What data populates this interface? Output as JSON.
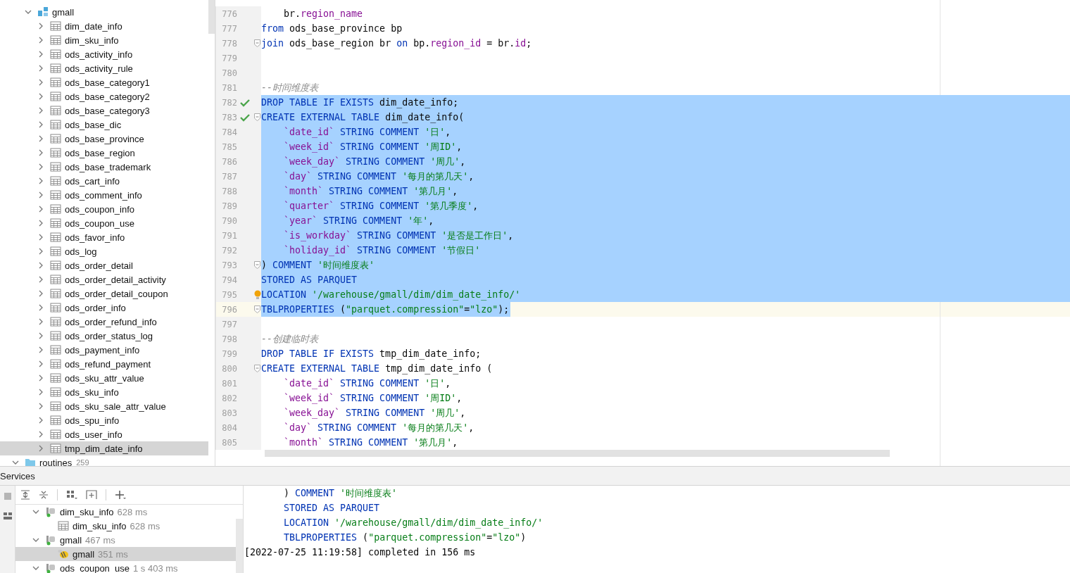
{
  "db_tree": {
    "schema": {
      "label": "gmall",
      "expanded": true,
      "children": [
        {
          "label": "dim_date_info",
          "selected": false
        },
        {
          "label": "dim_sku_info",
          "selected": false
        },
        {
          "label": "ods_activity_info",
          "selected": false
        },
        {
          "label": "ods_activity_rule",
          "selected": false
        },
        {
          "label": "ods_base_category1",
          "selected": false
        },
        {
          "label": "ods_base_category2",
          "selected": false
        },
        {
          "label": "ods_base_category3",
          "selected": false
        },
        {
          "label": "ods_base_dic",
          "selected": false
        },
        {
          "label": "ods_base_province",
          "selected": false
        },
        {
          "label": "ods_base_region",
          "selected": false
        },
        {
          "label": "ods_base_trademark",
          "selected": false
        },
        {
          "label": "ods_cart_info",
          "selected": false
        },
        {
          "label": "ods_comment_info",
          "selected": false
        },
        {
          "label": "ods_coupon_info",
          "selected": false
        },
        {
          "label": "ods_coupon_use",
          "selected": false
        },
        {
          "label": "ods_favor_info",
          "selected": false
        },
        {
          "label": "ods_log",
          "selected": false
        },
        {
          "label": "ods_order_detail",
          "selected": false
        },
        {
          "label": "ods_order_detail_activity",
          "selected": false
        },
        {
          "label": "ods_order_detail_coupon",
          "selected": false
        },
        {
          "label": "ods_order_info",
          "selected": false
        },
        {
          "label": "ods_order_refund_info",
          "selected": false
        },
        {
          "label": "ods_order_status_log",
          "selected": false
        },
        {
          "label": "ods_payment_info",
          "selected": false
        },
        {
          "label": "ods_refund_payment",
          "selected": false
        },
        {
          "label": "ods_sku_attr_value",
          "selected": false
        },
        {
          "label": "ods_sku_info",
          "selected": false
        },
        {
          "label": "ods_sku_sale_attr_value",
          "selected": false
        },
        {
          "label": "ods_spu_info",
          "selected": false
        },
        {
          "label": "ods_user_info",
          "selected": false
        },
        {
          "label": "tmp_dim_date_info",
          "selected": true
        }
      ]
    },
    "routines": {
      "label": "routines",
      "count": "259",
      "expanded": true
    }
  },
  "editor": {
    "lines": [
      {
        "no": "776",
        "indented": true,
        "selected": false,
        "current": false,
        "fold": false,
        "ok": false,
        "bulb": false,
        "segs": [
          {
            "kind": "plain",
            "text": "br."
          },
          {
            "kind": "field",
            "text": "region_name"
          }
        ]
      },
      {
        "no": "777",
        "indented": false,
        "selected": false,
        "current": false,
        "fold": false,
        "ok": false,
        "bulb": false,
        "segs": [
          {
            "kind": "keyword",
            "text": "from"
          },
          {
            "kind": "plain",
            "text": " ods_base_province bp"
          }
        ]
      },
      {
        "no": "778",
        "indented": false,
        "selected": false,
        "current": false,
        "fold": true,
        "ok": false,
        "bulb": false,
        "segs": [
          {
            "kind": "keyword",
            "text": "join"
          },
          {
            "kind": "plain",
            "text": " ods_base_region br "
          },
          {
            "kind": "keyword",
            "text": "on"
          },
          {
            "kind": "plain",
            "text": " bp."
          },
          {
            "kind": "field",
            "text": "region_id"
          },
          {
            "kind": "plain",
            "text": " = br."
          },
          {
            "kind": "field",
            "text": "id"
          },
          {
            "kind": "plain",
            "text": ";"
          }
        ]
      },
      {
        "no": "779",
        "selected": false,
        "current": false,
        "fold": false,
        "ok": false,
        "bulb": false
      },
      {
        "no": "780",
        "selected": false,
        "current": false,
        "fold": false,
        "ok": false,
        "bulb": false
      },
      {
        "no": "781",
        "indented": false,
        "selected": false,
        "current": false,
        "fold": false,
        "ok": false,
        "bulb": false,
        "segs": [
          {
            "kind": "comment",
            "text": "--时间维度表"
          }
        ]
      },
      {
        "no": "782",
        "indented": false,
        "selected": true,
        "current": false,
        "fold": false,
        "ok": true,
        "bulb": false,
        "segs": [
          {
            "kind": "keyword",
            "text": "DROP TABLE IF EXISTS"
          },
          {
            "kind": "plain",
            "text": " dim_date_info;"
          }
        ]
      },
      {
        "no": "783",
        "indented": false,
        "selected": true,
        "current": false,
        "fold": true,
        "ok": true,
        "bulb": false,
        "segs": [
          {
            "kind": "keyword",
            "text": "CREATE EXTERNAL TABLE"
          },
          {
            "kind": "plain",
            "text": " dim_date_info("
          }
        ]
      },
      {
        "no": "784",
        "indented": true,
        "selected": true,
        "current": false,
        "fold": false,
        "ok": false,
        "bulb": false,
        "segs": [
          {
            "kind": "field",
            "text": "`date_id`"
          },
          {
            "kind": "keyword",
            "text": " STRING COMMENT"
          },
          {
            "kind": "string",
            "text": " '日'"
          },
          {
            "kind": "plain",
            "text": ","
          }
        ]
      },
      {
        "no": "785",
        "indented": true,
        "selected": true,
        "current": false,
        "fold": false,
        "ok": false,
        "bulb": false,
        "segs": [
          {
            "kind": "field",
            "text": "`week_id`"
          },
          {
            "kind": "keyword",
            "text": " STRING COMMENT"
          },
          {
            "kind": "string",
            "text": " '周ID'"
          },
          {
            "kind": "plain",
            "text": ","
          }
        ]
      },
      {
        "no": "786",
        "indented": true,
        "selected": true,
        "current": false,
        "fold": false,
        "ok": false,
        "bulb": false,
        "segs": [
          {
            "kind": "field",
            "text": "`week_day`"
          },
          {
            "kind": "keyword",
            "text": " STRING COMMENT"
          },
          {
            "kind": "string",
            "text": " '周几'"
          },
          {
            "kind": "plain",
            "text": ","
          }
        ]
      },
      {
        "no": "787",
        "indented": true,
        "selected": true,
        "current": false,
        "fold": false,
        "ok": false,
        "bulb": false,
        "segs": [
          {
            "kind": "field",
            "text": "`day`"
          },
          {
            "kind": "keyword",
            "text": " STRING COMMENT"
          },
          {
            "kind": "string",
            "text": " '每月的第几天'"
          },
          {
            "kind": "plain",
            "text": ","
          }
        ]
      },
      {
        "no": "788",
        "indented": true,
        "selected": true,
        "current": false,
        "fold": false,
        "ok": false,
        "bulb": false,
        "segs": [
          {
            "kind": "field",
            "text": "`month`"
          },
          {
            "kind": "keyword",
            "text": " STRING COMMENT"
          },
          {
            "kind": "string",
            "text": " '第几月'"
          },
          {
            "kind": "plain",
            "text": ","
          }
        ]
      },
      {
        "no": "789",
        "indented": true,
        "selected": true,
        "current": false,
        "fold": false,
        "ok": false,
        "bulb": false,
        "segs": [
          {
            "kind": "field",
            "text": "`quarter`"
          },
          {
            "kind": "keyword",
            "text": " STRING COMMENT"
          },
          {
            "kind": "string",
            "text": " '第几季度'"
          },
          {
            "kind": "plain",
            "text": ","
          }
        ]
      },
      {
        "no": "790",
        "indented": true,
        "selected": true,
        "current": false,
        "fold": false,
        "ok": false,
        "bulb": false,
        "segs": [
          {
            "kind": "field",
            "text": "`year`"
          },
          {
            "kind": "keyword",
            "text": " STRING COMMENT"
          },
          {
            "kind": "string",
            "text": " '年'"
          },
          {
            "kind": "plain",
            "text": ","
          }
        ]
      },
      {
        "no": "791",
        "indented": true,
        "selected": true,
        "current": false,
        "fold": false,
        "ok": false,
        "bulb": false,
        "segs": [
          {
            "kind": "field",
            "text": "`is_workday`"
          },
          {
            "kind": "keyword",
            "text": " STRING COMMENT"
          },
          {
            "kind": "string",
            "text": " '是否是工作日'"
          },
          {
            "kind": "plain",
            "text": ","
          }
        ]
      },
      {
        "no": "792",
        "indented": true,
        "selected": true,
        "current": false,
        "fold": false,
        "ok": false,
        "bulb": false,
        "segs": [
          {
            "kind": "field",
            "text": "`holiday_id`"
          },
          {
            "kind": "keyword",
            "text": " STRING COMMENT"
          },
          {
            "kind": "string",
            "text": " '节假日'"
          }
        ]
      },
      {
        "no": "793",
        "indented": false,
        "selected": true,
        "current": false,
        "fold": true,
        "ok": false,
        "bulb": false,
        "segs": [
          {
            "kind": "plain",
            "text": ")"
          },
          {
            "kind": "keyword",
            "text": " COMMENT"
          },
          {
            "kind": "string",
            "text": " '时间维度表'"
          }
        ]
      },
      {
        "no": "794",
        "indented": false,
        "selected": true,
        "current": false,
        "fold": false,
        "ok": false,
        "bulb": false,
        "segs": [
          {
            "kind": "keyword",
            "text": "STORED AS PARQUET"
          }
        ]
      },
      {
        "no": "795",
        "indented": false,
        "selected": true,
        "current": false,
        "fold": false,
        "ok": false,
        "bulb": true,
        "segs": [
          {
            "kind": "keyword",
            "text": "LOCATION"
          },
          {
            "kind": "string",
            "text": " '/warehouse/gmall/dim/dim_date_info/'"
          }
        ]
      },
      {
        "no": "796",
        "indented": false,
        "selected": true,
        "current": true,
        "fold": true,
        "ok": false,
        "bulb": false,
        "segs": [
          {
            "kind": "keyword",
            "text": "TBLPROPERTIES"
          },
          {
            "kind": "plain",
            "text": " ("
          },
          {
            "kind": "string",
            "text": "\"parquet.compression\""
          },
          {
            "kind": "plain",
            "text": "="
          },
          {
            "kind": "string",
            "text": "\"lzo\""
          },
          {
            "kind": "plain",
            "text": ");"
          }
        ]
      },
      {
        "no": "797",
        "selected": false,
        "current": false,
        "fold": false,
        "ok": false,
        "bulb": false
      },
      {
        "no": "798",
        "indented": false,
        "selected": false,
        "current": false,
        "fold": false,
        "ok": false,
        "bulb": false,
        "segs": [
          {
            "kind": "comment",
            "text": "--创建临时表"
          }
        ]
      },
      {
        "no": "799",
        "indented": false,
        "selected": false,
        "current": false,
        "fold": false,
        "ok": false,
        "bulb": false,
        "segs": [
          {
            "kind": "keyword",
            "text": "DROP TABLE IF EXISTS"
          },
          {
            "kind": "plain",
            "text": " tmp_dim_date_info;"
          }
        ]
      },
      {
        "no": "800",
        "indented": false,
        "selected": false,
        "current": false,
        "fold": true,
        "ok": false,
        "bulb": false,
        "segs": [
          {
            "kind": "keyword",
            "text": "CREATE EXTERNAL TABLE"
          },
          {
            "kind": "plain",
            "text": " tmp_dim_date_info ("
          }
        ]
      },
      {
        "no": "801",
        "indented": true,
        "selected": false,
        "current": false,
        "fold": false,
        "ok": false,
        "bulb": false,
        "segs": [
          {
            "kind": "field",
            "text": "`date_id`"
          },
          {
            "kind": "keyword",
            "text": " STRING COMMENT"
          },
          {
            "kind": "string",
            "text": " '日'"
          },
          {
            "kind": "plain",
            "text": ","
          }
        ]
      },
      {
        "no": "802",
        "indented": true,
        "selected": false,
        "current": false,
        "fold": false,
        "ok": false,
        "bulb": false,
        "segs": [
          {
            "kind": "field",
            "text": "`week_id`"
          },
          {
            "kind": "keyword",
            "text": " STRING COMMENT"
          },
          {
            "kind": "string",
            "text": " '周ID'"
          },
          {
            "kind": "plain",
            "text": ","
          }
        ]
      },
      {
        "no": "803",
        "indented": true,
        "selected": false,
        "current": false,
        "fold": false,
        "ok": false,
        "bulb": false,
        "segs": [
          {
            "kind": "field",
            "text": "`week_day`"
          },
          {
            "kind": "keyword",
            "text": " STRING COMMENT"
          },
          {
            "kind": "string",
            "text": " '周几'"
          },
          {
            "kind": "plain",
            "text": ","
          }
        ]
      },
      {
        "no": "804",
        "indented": true,
        "selected": false,
        "current": false,
        "fold": false,
        "ok": false,
        "bulb": false,
        "segs": [
          {
            "kind": "field",
            "text": "`day`"
          },
          {
            "kind": "keyword",
            "text": " STRING COMMENT"
          },
          {
            "kind": "string",
            "text": " '每月的第几天'"
          },
          {
            "kind": "plain",
            "text": ","
          }
        ]
      },
      {
        "no": "805",
        "indented": true,
        "selected": false,
        "current": false,
        "fold": false,
        "ok": false,
        "bulb": false,
        "segs": [
          {
            "kind": "field",
            "text": "`month`"
          },
          {
            "kind": "keyword",
            "text": " STRING COMMENT"
          },
          {
            "kind": "string",
            "text": " '第几月'"
          },
          {
            "kind": "plain",
            "text": ","
          }
        ]
      }
    ]
  },
  "services": {
    "title": "Services",
    "tree": [
      {
        "label": "dim_sku_info",
        "time": "628 ms",
        "expanded": true,
        "selected": false,
        "children": [
          {
            "label": "dim_sku_info",
            "time": "628 ms",
            "kind": "table",
            "selected": false
          }
        ]
      },
      {
        "label": "gmall",
        "time": "467 ms",
        "expanded": true,
        "selected": false,
        "children": [
          {
            "label": "gmall",
            "time": "351 ms",
            "kind": "hive",
            "selected": true
          }
        ]
      },
      {
        "label": "ods_coupon_use",
        "time": "1 s 403 ms",
        "expanded": true,
        "selected": false
      }
    ],
    "output": {
      "statement": [
        {
          "segs": [
            {
              "kind": "plain",
              "text": ")"
            },
            {
              "kind": "keyword",
              "text": " COMMENT"
            },
            {
              "kind": "string",
              "text": " '时间维度表'"
            }
          ]
        },
        {
          "segs": [
            {
              "kind": "keyword",
              "text": "STORED AS PARQUET"
            }
          ]
        },
        {
          "segs": [
            {
              "kind": "keyword",
              "text": "LOCATION"
            },
            {
              "kind": "string",
              "text": " '/warehouse/gmall/dim/dim_date_info/'"
            }
          ]
        },
        {
          "segs": [
            {
              "kind": "keyword",
              "text": "TBLPROPERTIES"
            },
            {
              "kind": "plain",
              "text": " ("
            },
            {
              "kind": "string",
              "text": "\"parquet.compression\""
            },
            {
              "kind": "plain",
              "text": "="
            },
            {
              "kind": "string",
              "text": "\"lzo\""
            },
            {
              "kind": "plain",
              "text": ")"
            }
          ]
        }
      ],
      "log": "[2022-07-25 11:19:58] completed in 156 ms"
    }
  }
}
